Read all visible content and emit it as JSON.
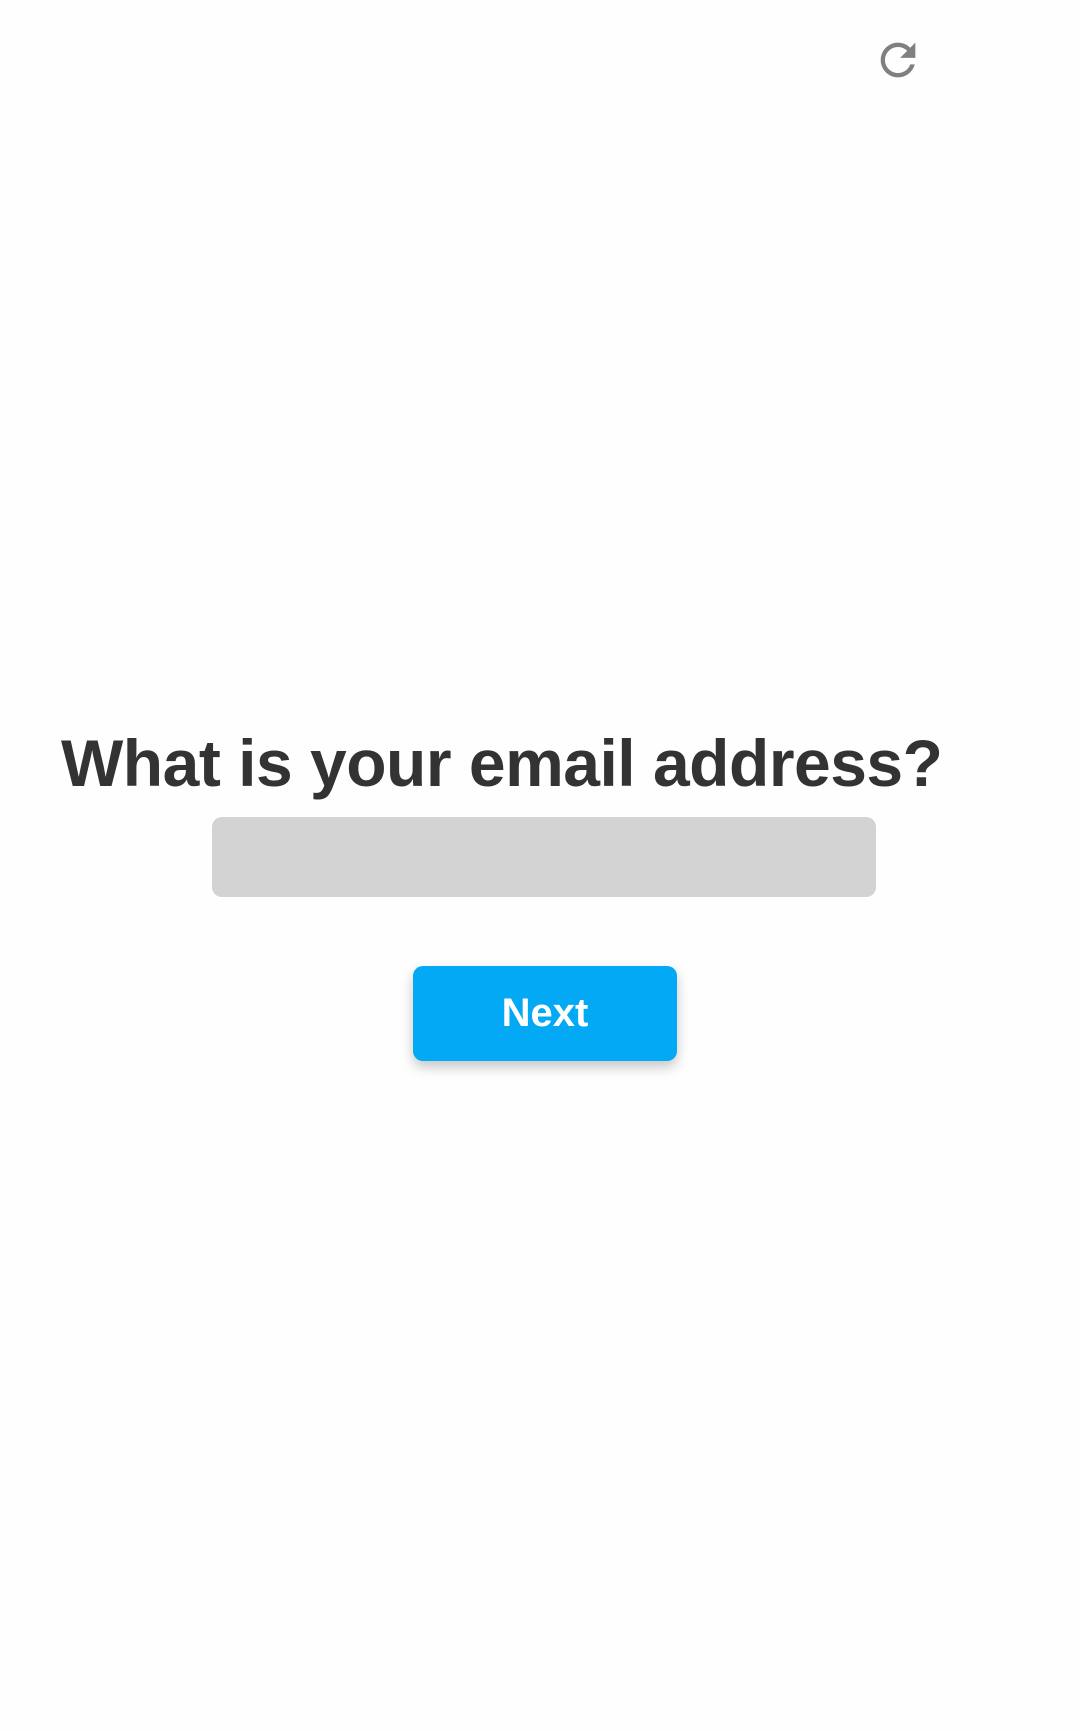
{
  "toolbar": {
    "refresh_icon": "refresh-icon"
  },
  "form": {
    "question": "What is your email address?",
    "email_value": "",
    "email_placeholder": "",
    "next_label": "Next"
  },
  "colors": {
    "accent": "#03a9f4",
    "input_bg": "#d3d3d3",
    "text": "#333333",
    "icon": "#808080"
  }
}
